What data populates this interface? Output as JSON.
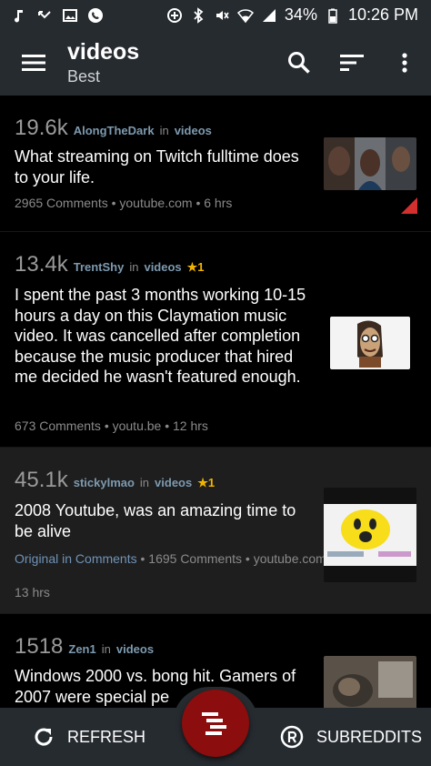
{
  "status_bar": {
    "battery": "34%",
    "time": "10:26 PM"
  },
  "toolbar": {
    "title": "videos",
    "subtitle": "Best"
  },
  "posts": [
    {
      "score": "19.6k",
      "author": "AlongTheDark",
      "in_text": "in",
      "subreddit": "videos",
      "title": "What streaming on Twitch fulltime does to your life.",
      "info": "2965 Comments • youtube.com • 6 hrs"
    },
    {
      "score": "13.4k",
      "author": "TrentShy",
      "in_text": "in",
      "subreddit": "videos",
      "award": "★1",
      "title": "I spent the past 3 months working 10-15 hours a day on this Claymation music video. It was cancelled after completion because the music producer that hired me decided he wasn't featured enough.",
      "info": "673 Comments • youtu.be • 12 hrs"
    },
    {
      "score": "45.1k",
      "author": "stickylmao",
      "in_text": "in",
      "subreddit": "videos",
      "award": "★1",
      "title": "2008 Youtube, was an amazing time to be alive",
      "info_link": "Original in Comments",
      "info": " • 1695 Comments • youtube.com •",
      "info_line2": "13 hrs"
    },
    {
      "score": "1518",
      "author": "Zen1",
      "in_text": "in",
      "subreddit": "videos",
      "title": "Windows 2000 vs. bong hit. Gamers of 2007 were special pe"
    }
  ],
  "bottom_bar": {
    "refresh_label": "REFRESH",
    "subreddits_label": "SUBREDDITS"
  },
  "colors": {
    "bar_bg": "#262b30",
    "fab": "#8b0d0d",
    "nsfw_corner": "#d32f2f",
    "link": "#7d9ab0"
  }
}
